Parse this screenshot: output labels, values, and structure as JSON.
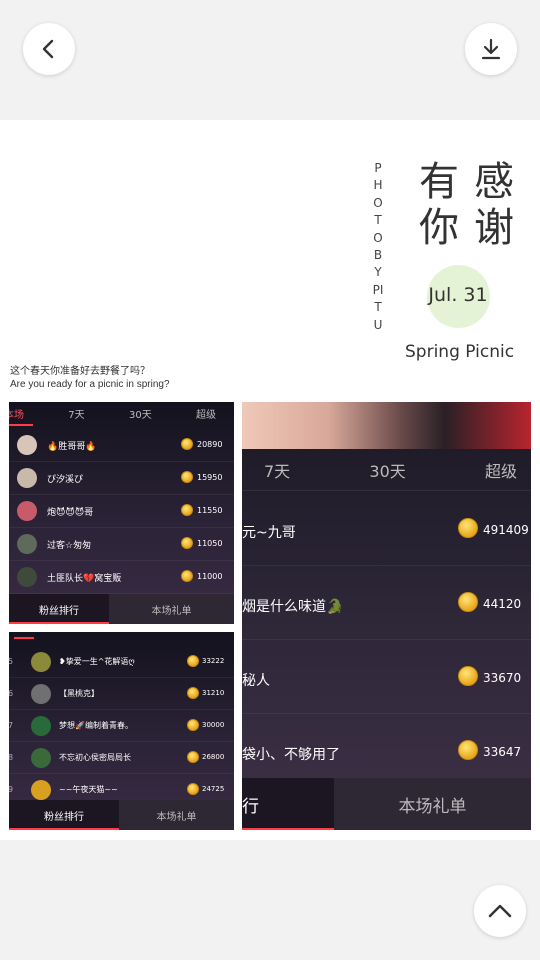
{
  "poster": {
    "vertical_text": "PHOTOBYPITU",
    "chars": [
      "有",
      "感",
      "你",
      "谢"
    ],
    "date": "Jul. 31",
    "subtitle": "Spring Picnic",
    "question_cn": "这个春天你准备好去野餐了吗？",
    "question_en": "Are you ready for a picnic in spring?"
  },
  "panel1": {
    "tabs": [
      "本场",
      "7天",
      "30天",
      "超级"
    ],
    "rows": [
      {
        "name": "🔥胜哥哥🔥",
        "score": "20890",
        "avatar_color": "#d9c4b8"
      },
      {
        "name": "ぴ汐溪ぴ",
        "score": "15950",
        "avatar_color": "#c9b9a8"
      },
      {
        "name": "炮😈😈😈哥",
        "score": "11550",
        "avatar_color": "#c85a6a"
      },
      {
        "name": "过客☆匆匆",
        "score": "11050",
        "avatar_color": "#5e6a5a"
      },
      {
        "name": "土匪队长💔窝宝贩",
        "score": "11000",
        "avatar_color": "#3e4a3a"
      }
    ],
    "bottom_left": "粉丝排行",
    "bottom_right": "本场礼单"
  },
  "panel2": {
    "rows": [
      {
        "rank": "5",
        "name": "❥挚爱一生^花解语ღ",
        "score": "33222",
        "avatar_color": "#8a8a3a"
      },
      {
        "rank": "6",
        "name": "【黑桃克】",
        "score": "31210",
        "avatar_color": "#707070"
      },
      {
        "rank": "7",
        "name": "梦想🚀编制着青春。",
        "score": "30000",
        "avatar_color": "#2a6a3a"
      },
      {
        "rank": "8",
        "name": "不忘初心侯密局局长",
        "score": "26800",
        "avatar_color": "#3a6a3a"
      },
      {
        "rank": "9",
        "name": "~~午夜天猫~~",
        "score": "24725",
        "avatar_color": "#d8a020"
      }
    ],
    "bottom_left": "粉丝排行",
    "bottom_right": "本场礼单"
  },
  "panel3": {
    "tabs": [
      "7天",
      "30天",
      "超级"
    ],
    "rows": [
      {
        "name": "元~九哥",
        "score": "491409"
      },
      {
        "name": "烟是什么味道🐊",
        "score": "44120"
      },
      {
        "name": "秘人",
        "score": "33670"
      },
      {
        "name": "袋小、不够用了",
        "score": "33647"
      }
    ],
    "bottom_left": "行",
    "bottom_right": "本场礼单"
  },
  "colors": {
    "accent": "#ff3b4a",
    "date_circle": "#e4f3d5"
  },
  "icons": [
    "back-arrow-icon",
    "download-icon",
    "scroll-top-icon",
    "coin-icon"
  ]
}
